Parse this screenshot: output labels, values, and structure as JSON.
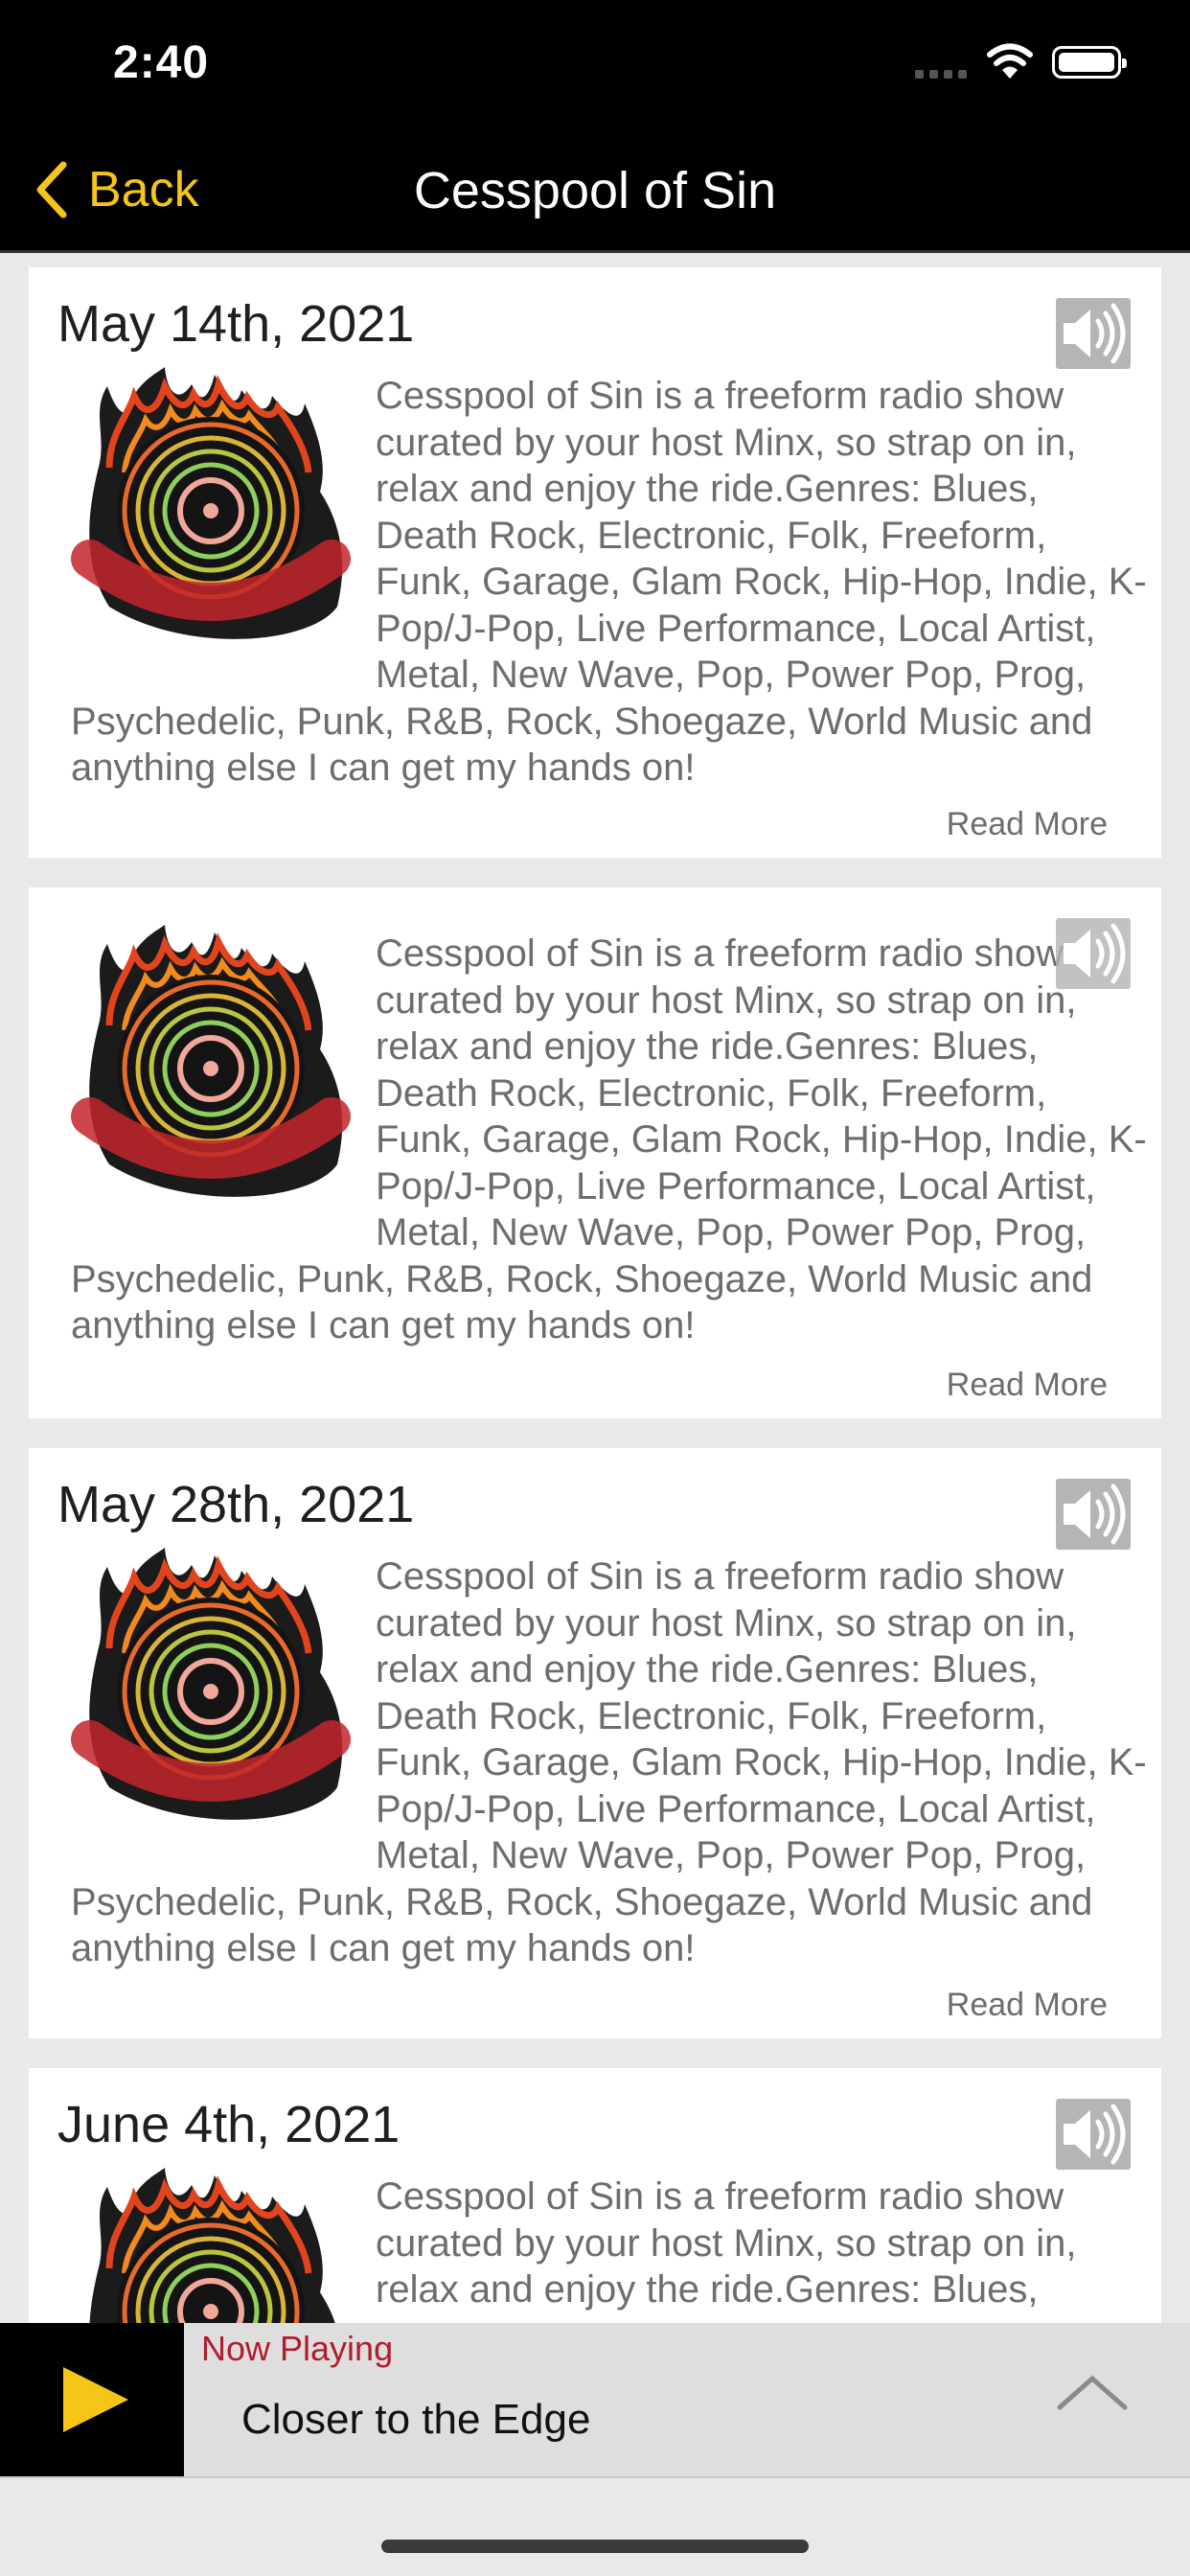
{
  "status_bar": {
    "time": "2:40"
  },
  "nav": {
    "back_label": "Back",
    "title": "Cesspool of Sin"
  },
  "episodes": [
    {
      "date": "May 14th, 2021",
      "description": "Cesspool of Sin is a freeform radio show curated by your host Minx, so strap on in, relax and enjoy the ride.Genres: Blues, Death Rock, Electronic, Folk, Freeform, Funk, Garage, Glam Rock, Hip-Hop, Indie, K-Pop/J-Pop, Live Performance, Local Artist, Metal, New Wave, Pop, Power Pop, Prog, Psychedelic, Punk, R&B, Rock, Shoegaze, World Music and anything else I can get my hands on!",
      "read_more": "Read More"
    },
    {
      "date": "",
      "description": "Cesspool of Sin is a freeform radio show curated by your host Minx, so strap on in, relax and enjoy the ride.Genres: Blues, Death Rock, Electronic, Folk, Freeform, Funk, Garage, Glam Rock, Hip-Hop, Indie, K-Pop/J-Pop, Live Performance, Local Artist, Metal, New Wave, Pop, Power Pop, Prog, Psychedelic, Punk, R&B, Rock, Shoegaze, World Music and anything else I can get my hands on!",
      "read_more": "Read More"
    },
    {
      "date": "May 28th, 2021",
      "description": "Cesspool of Sin is a freeform radio show curated by your host Minx, so strap on in, relax and enjoy the ride.Genres: Blues, Death Rock, Electronic, Folk, Freeform, Funk, Garage, Glam Rock, Hip-Hop, Indie, K-Pop/J-Pop, Live Performance, Local Artist, Metal, New Wave, Pop, Power Pop, Prog, Psychedelic, Punk, R&B, Rock, Shoegaze, World Music and anything else I can get my hands on!",
      "read_more": "Read More"
    },
    {
      "date": "June 4th, 2021",
      "description": "Cesspool of Sin is a freeform radio show curated by your host Minx, so strap on in, relax and enjoy the ride.Genres: Blues,",
      "read_more": ""
    }
  ],
  "logo_text": "CESSPOOL OF SIN",
  "now_playing": {
    "label": "Now Playing",
    "title": "Closer to the Edge"
  },
  "colors": {
    "accent": "#f5c518",
    "now_playing_label": "#b01c2e",
    "header_bg": "#000000"
  },
  "icons": [
    "back-chevron-icon",
    "speaker-icon",
    "play-icon",
    "chevron-up-icon",
    "wifi-icon",
    "battery-icon"
  ]
}
